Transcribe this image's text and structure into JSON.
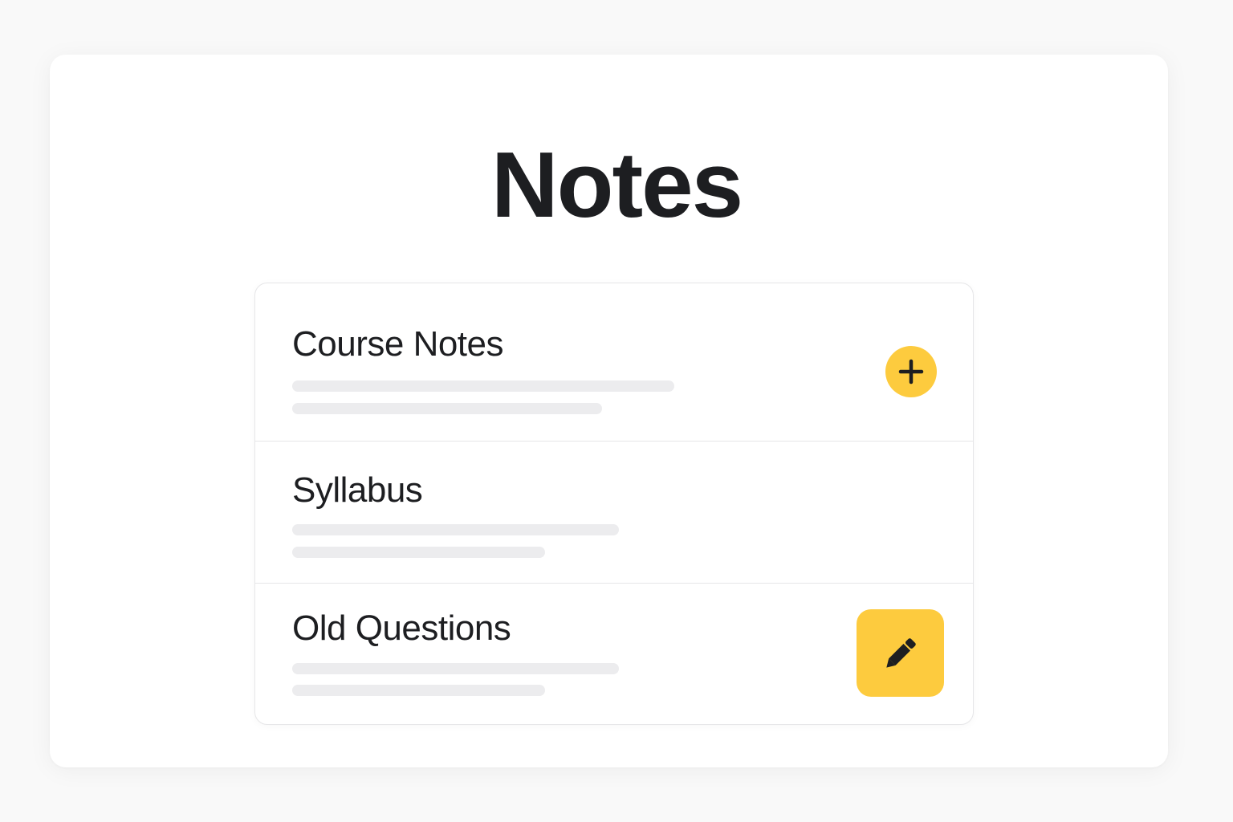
{
  "page": {
    "title": "Notes"
  },
  "notes": [
    {
      "title": "Course Notes",
      "action": "add"
    },
    {
      "title": "Syllabus"
    },
    {
      "title": "Old Questions",
      "action": "edit"
    }
  ],
  "icons": {
    "add": "plus-icon",
    "edit": "pencil-icon"
  },
  "colors": {
    "accent": "#fdcb3e",
    "text": "#1d1e21",
    "placeholder": "#ececee",
    "divider": "#e6e6e8",
    "background": "#f9f9f9",
    "card": "#ffffff"
  }
}
